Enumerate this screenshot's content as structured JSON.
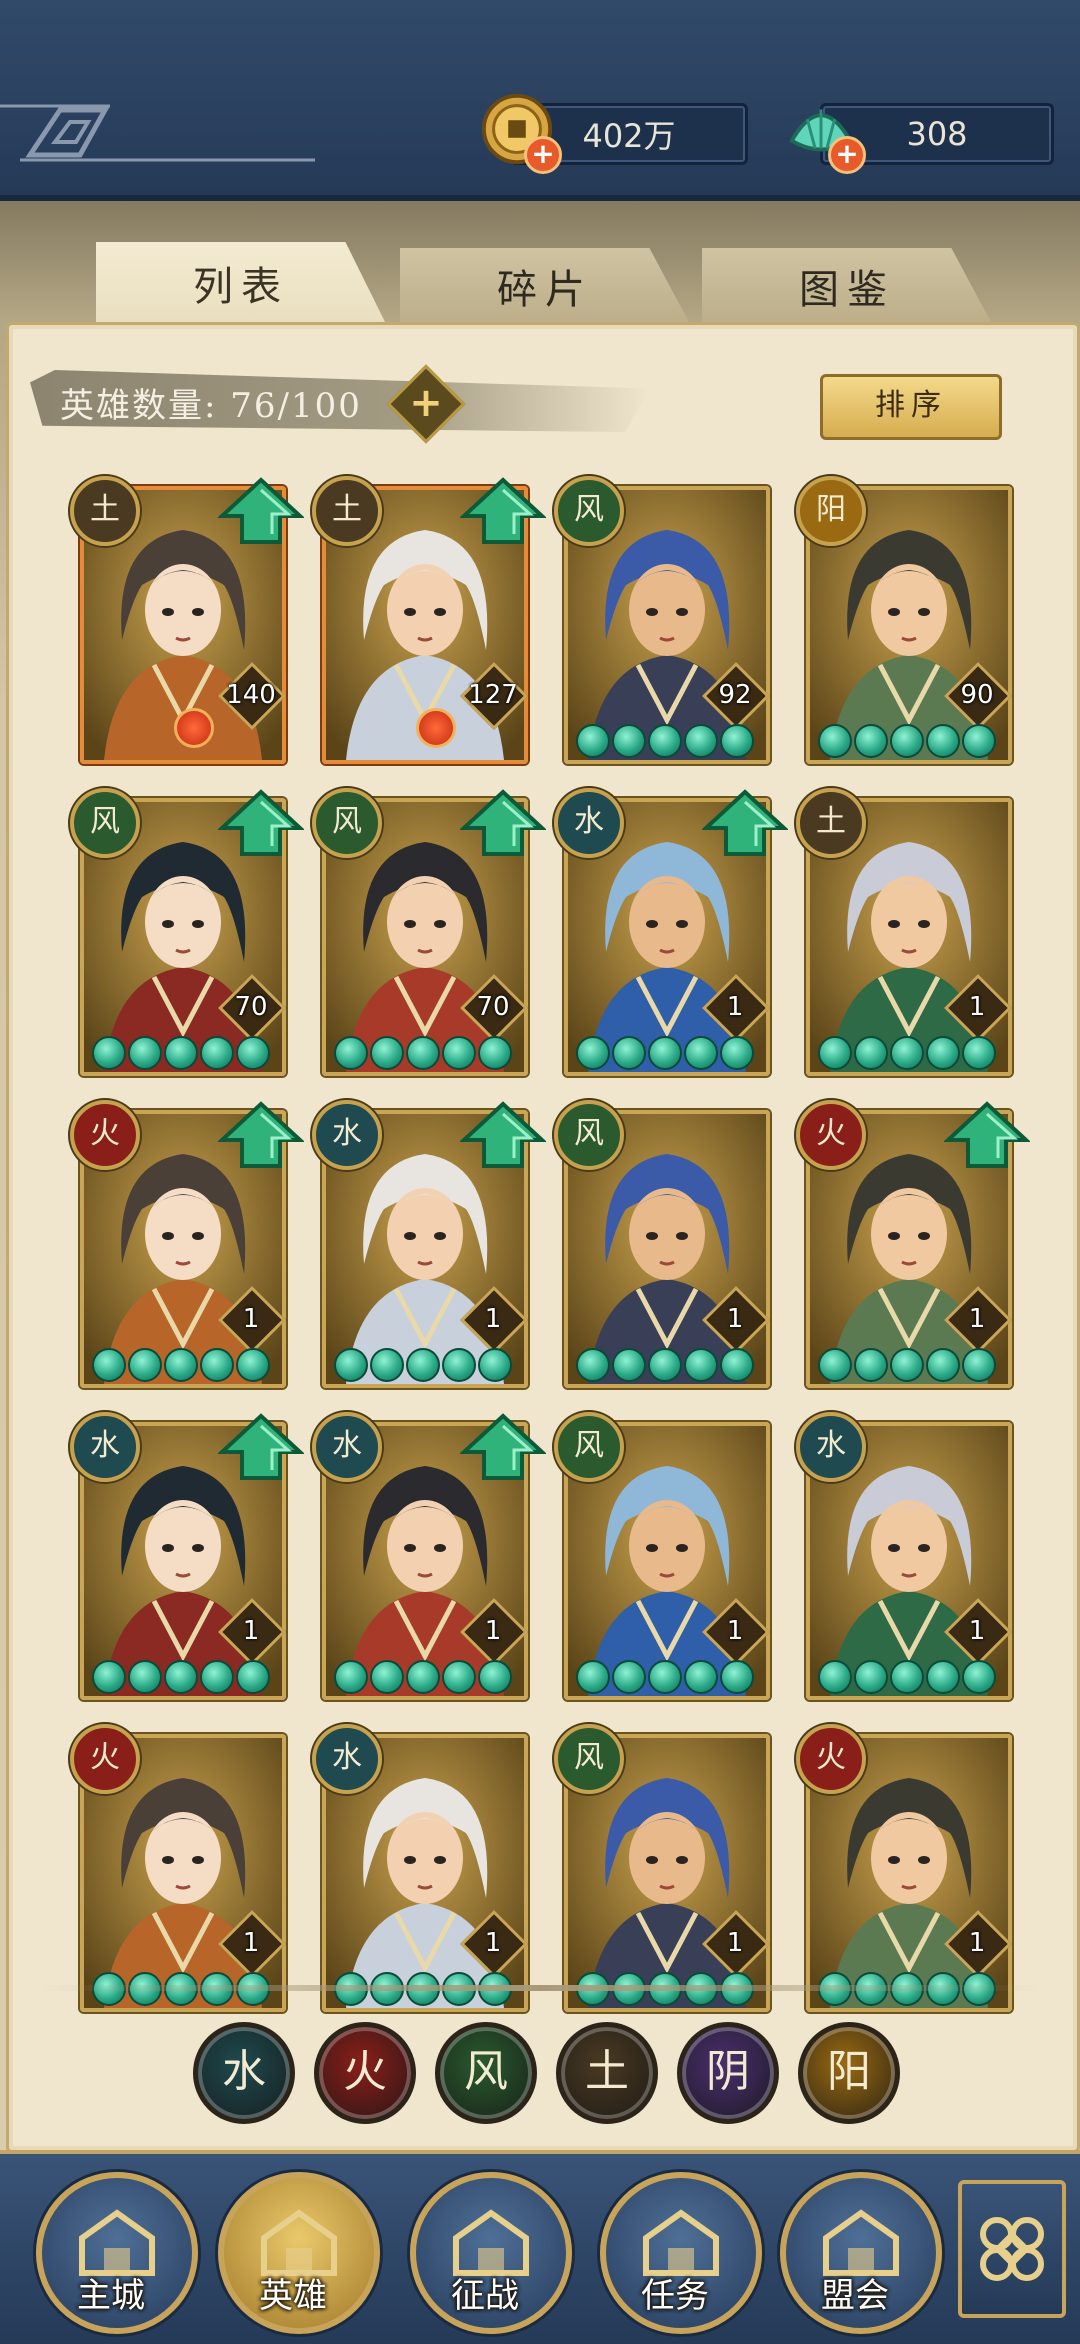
{
  "currency": {
    "gold": {
      "value": "402万",
      "icon": "coin-icon"
    },
    "jade": {
      "value": "308",
      "icon": "jade-shell-icon"
    }
  },
  "tabs": [
    {
      "label": "列表",
      "active": true
    },
    {
      "label": "碎片",
      "active": false
    },
    {
      "label": "图鉴",
      "active": false
    }
  ],
  "hero_count": {
    "label": "英雄数量: 76/100"
  },
  "sort_button": {
    "label": "排序"
  },
  "heroes": [
    {
      "element": "土",
      "level": "140",
      "upgrade": true,
      "stars": 0,
      "frame": "orange",
      "rune": true
    },
    {
      "element": "土",
      "level": "127",
      "upgrade": true,
      "stars": 0,
      "frame": "orange",
      "rune": true
    },
    {
      "element": "风",
      "level": "92",
      "upgrade": false,
      "stars": 5,
      "frame": "gold"
    },
    {
      "element": "阳",
      "level": "90",
      "upgrade": false,
      "stars": 5,
      "frame": "gold"
    },
    {
      "element": "风",
      "level": "70",
      "upgrade": true,
      "stars": 5,
      "frame": "gold"
    },
    {
      "element": "风",
      "level": "70",
      "upgrade": true,
      "stars": 5,
      "frame": "gold"
    },
    {
      "element": "水",
      "level": "1",
      "upgrade": true,
      "stars": 5,
      "frame": "gold"
    },
    {
      "element": "土",
      "level": "1",
      "upgrade": false,
      "stars": 5,
      "frame": "gold"
    },
    {
      "element": "火",
      "level": "1",
      "upgrade": true,
      "stars": 5,
      "frame": "gold"
    },
    {
      "element": "水",
      "level": "1",
      "upgrade": true,
      "stars": 5,
      "frame": "gold"
    },
    {
      "element": "风",
      "level": "1",
      "upgrade": false,
      "stars": 5,
      "frame": "gold"
    },
    {
      "element": "火",
      "level": "1",
      "upgrade": true,
      "stars": 5,
      "frame": "gold"
    },
    {
      "element": "水",
      "level": "1",
      "upgrade": true,
      "stars": 5,
      "frame": "gold"
    },
    {
      "element": "水",
      "level": "1",
      "upgrade": true,
      "stars": 5,
      "frame": "gold"
    },
    {
      "element": "风",
      "level": "1",
      "upgrade": false,
      "stars": 5,
      "frame": "gold"
    },
    {
      "element": "水",
      "level": "1",
      "upgrade": false,
      "stars": 5,
      "frame": "gold"
    },
    {
      "element": "火",
      "level": "1",
      "upgrade": false,
      "stars": 5,
      "frame": "gold"
    },
    {
      "element": "水",
      "level": "1",
      "upgrade": false,
      "stars": 5,
      "frame": "gold"
    },
    {
      "element": "风",
      "level": "1",
      "upgrade": false,
      "stars": 5,
      "frame": "gold"
    },
    {
      "element": "火",
      "level": "1",
      "upgrade": false,
      "stars": 5,
      "frame": "gold"
    }
  ],
  "element_colors": {
    "水": "#1f4a4f",
    "火": "#8a1f1a",
    "风": "#2a5a2e",
    "土": "#4a3a22",
    "阴": "#4a2f6e",
    "阳": "#9a6a12"
  },
  "element_filters": [
    {
      "glyph": "水",
      "color": "#1f4a4f",
      "icon": "water-element-icon"
    },
    {
      "glyph": "火",
      "color": "#8a1f1a",
      "icon": "fire-element-icon"
    },
    {
      "glyph": "风",
      "color": "#2a5a2e",
      "icon": "wind-element-icon"
    },
    {
      "glyph": "土",
      "color": "#4a3a22",
      "icon": "earth-element-icon"
    },
    {
      "glyph": "阴",
      "color": "#4a2f6e",
      "icon": "yin-element-icon"
    },
    {
      "glyph": "阳",
      "color": "#9a6a12",
      "icon": "yang-element-icon"
    }
  ],
  "nav": [
    {
      "label": "主城",
      "icon": "city-gate-icon",
      "active": false
    },
    {
      "label": "英雄",
      "icon": "hero-portrait-icon",
      "active": true
    },
    {
      "label": "征战",
      "icon": "helmet-icon",
      "active": false
    },
    {
      "label": "任务",
      "icon": "scroll-flag-icon",
      "active": false
    },
    {
      "label": "盟会",
      "icon": "pavilion-icon",
      "active": false
    }
  ],
  "nav_menu_icon": "menu-knot-icon"
}
